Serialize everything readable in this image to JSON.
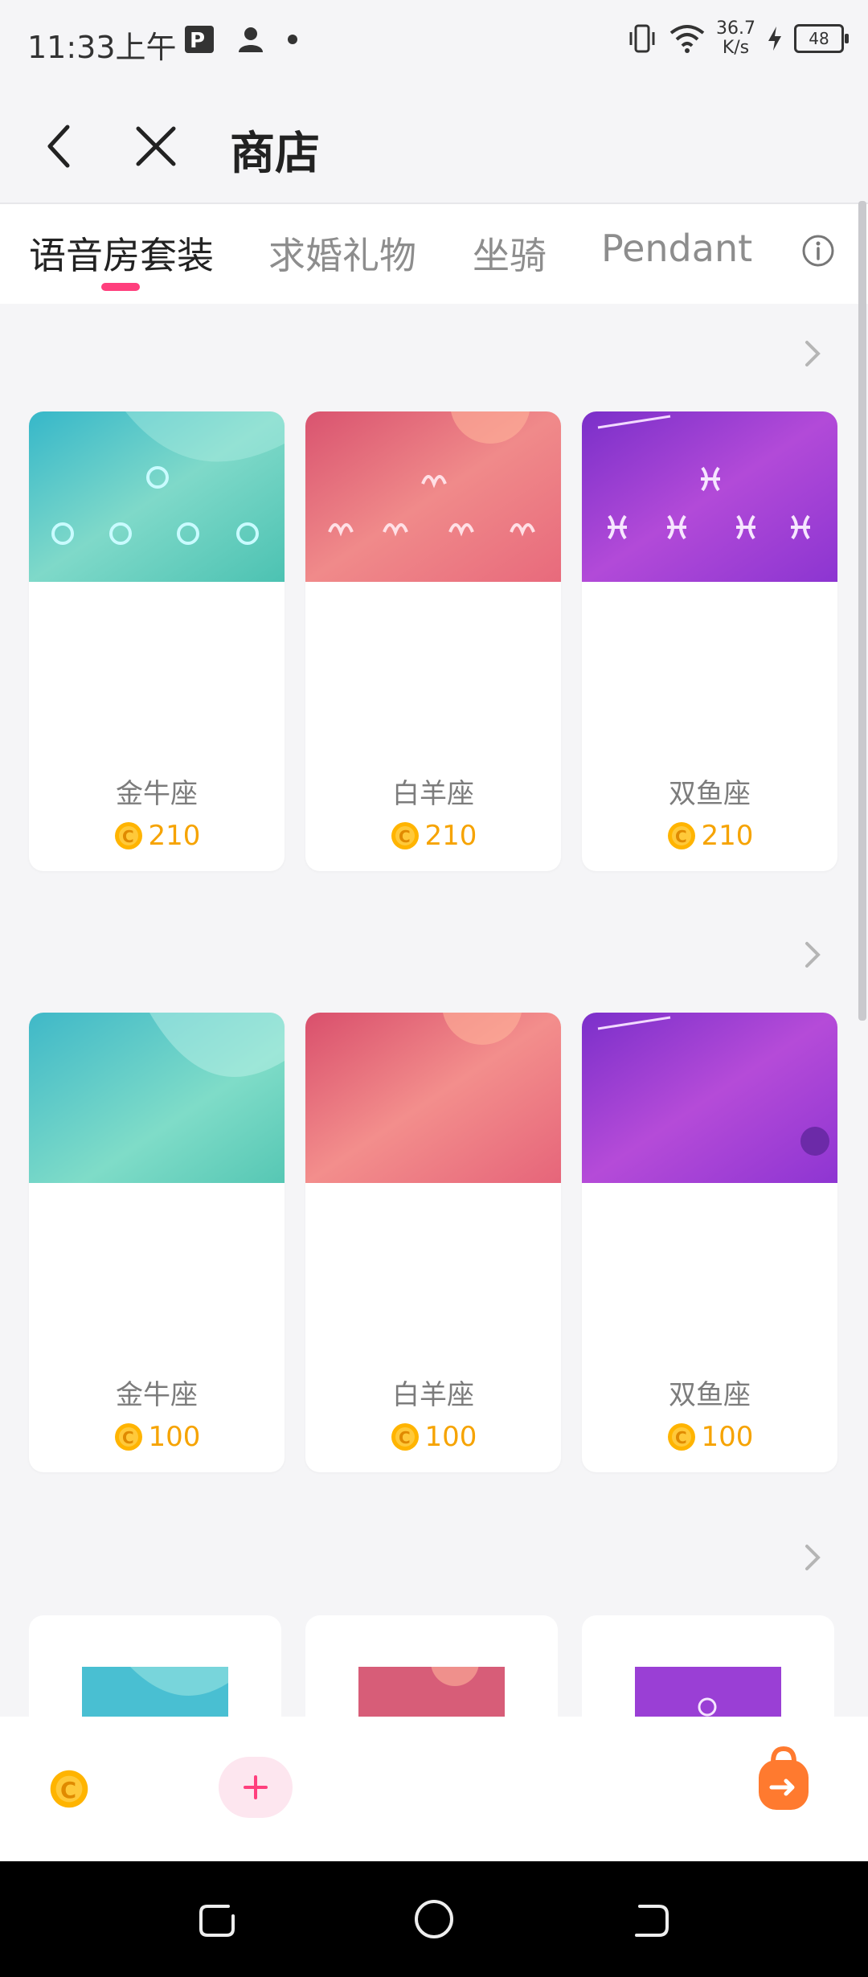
{
  "status_bar": {
    "time": "11:33上午",
    "net_speed_value": "36.7",
    "net_speed_unit": "K/s",
    "battery": "48"
  },
  "header": {
    "title": "商店"
  },
  "tabs": [
    {
      "label": "语音房套装",
      "active": true
    },
    {
      "label": "求婚礼物",
      "active": false
    },
    {
      "label": "坐骑",
      "active": false
    },
    {
      "label": "Pendant",
      "active": false
    }
  ],
  "sections": [
    {
      "items": [
        {
          "name": "金牛座",
          "price": "210"
        },
        {
          "name": "白羊座",
          "price": "210"
        },
        {
          "name": "双鱼座",
          "price": "210"
        }
      ]
    },
    {
      "items": [
        {
          "name": "金牛座",
          "price": "100"
        },
        {
          "name": "白羊座",
          "price": "100"
        },
        {
          "name": "双鱼座",
          "price": "100"
        }
      ]
    }
  ],
  "icons": {
    "back": "back-arrow-icon",
    "close": "close-icon",
    "info": "info-icon",
    "chevron": "chevron-right-icon",
    "coin": "coin-icon",
    "plus": "plus-icon",
    "bag": "backpack-icon"
  },
  "colors": {
    "accent": "#ff3f7d",
    "coin": "#f6a300",
    "price_text": "#f6a300",
    "bag": "#ff7a2f"
  }
}
